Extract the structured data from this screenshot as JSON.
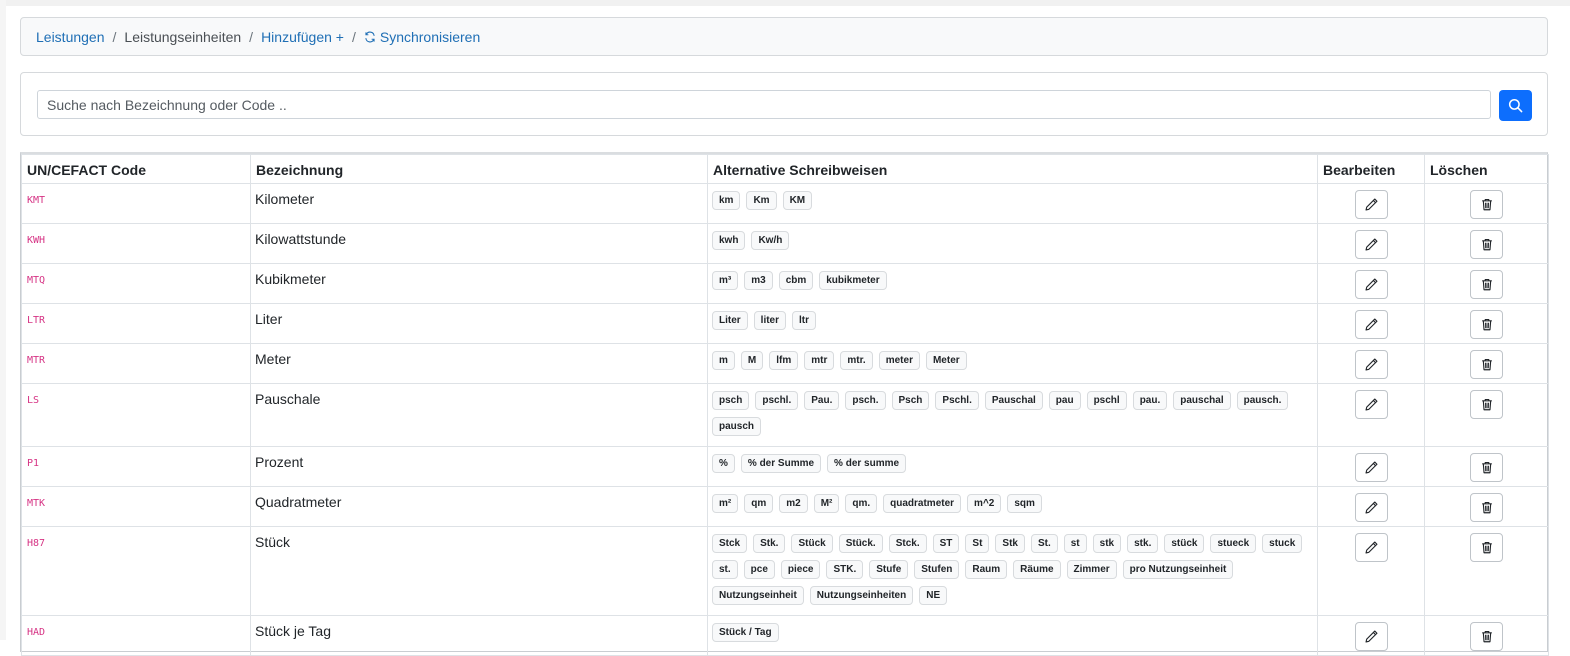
{
  "breadcrumb": {
    "leistungen": "Leistungen",
    "current": "Leistungseinheiten",
    "add": "Hinzufügen +",
    "sync": "Synchronisieren",
    "separator": "/"
  },
  "search": {
    "placeholder": "Suche nach Bezeichnung oder Code ..",
    "button_icon": "search-icon"
  },
  "colors": {
    "link": "#1f6fb5",
    "primary": "#0d6efd",
    "code": "#d63384"
  },
  "table": {
    "headers": {
      "code": "UN/CEFACT Code",
      "name": "Bezeichnung",
      "alts": "Alternative Schreibweisen",
      "edit": "Bearbeiten",
      "delete": "Löschen"
    },
    "rows": [
      {
        "code": "KMT",
        "name": "Kilometer",
        "alts": [
          "km",
          "Km",
          "KM"
        ]
      },
      {
        "code": "KWH",
        "name": "Kilowattstunde",
        "alts": [
          "kwh",
          "Kw/h"
        ]
      },
      {
        "code": "MTQ",
        "name": "Kubikmeter",
        "alts": [
          "m³",
          "m3",
          "cbm",
          "kubikmeter"
        ]
      },
      {
        "code": "LTR",
        "name": "Liter",
        "alts": [
          "Liter",
          "liter",
          "ltr"
        ]
      },
      {
        "code": "MTR",
        "name": "Meter",
        "alts": [
          "m",
          "M",
          "lfm",
          "mtr",
          "mtr.",
          "meter",
          "Meter"
        ]
      },
      {
        "code": "LS",
        "name": "Pauschale",
        "alts": [
          "psch",
          "pschl.",
          "Pau.",
          "psch.",
          "Psch",
          "Pschl.",
          "Pauschal",
          "pau",
          "pschl",
          "pau.",
          "pauschal",
          "pausch.",
          "pausch"
        ]
      },
      {
        "code": "P1",
        "name": "Prozent",
        "alts": [
          "%",
          "% der Summe",
          "% der summe"
        ]
      },
      {
        "code": "MTK",
        "name": "Quadratmeter",
        "alts": [
          "m²",
          "qm",
          "m2",
          "M²",
          "qm.",
          "quadratmeter",
          "m^2",
          "sqm"
        ]
      },
      {
        "code": "H87",
        "name": "Stück",
        "alts": [
          "Stck",
          "Stk.",
          "Stück",
          "Stück.",
          "Stck.",
          "ST",
          "St",
          "Stk",
          "St.",
          "st",
          "stk",
          "stk.",
          "stück",
          "stueck",
          "stuck",
          "st.",
          "pce",
          "piece",
          "STK.",
          "Stufe",
          "Stufen",
          "Raum",
          "Räume",
          "Zimmer",
          "pro Nutzungseinheit",
          "Nutzungseinheit",
          "Nutzungseinheiten",
          "NE"
        ]
      },
      {
        "code": "HAD",
        "name": "Stück je Tag",
        "alts": [
          "Stück / Tag"
        ]
      }
    ]
  }
}
